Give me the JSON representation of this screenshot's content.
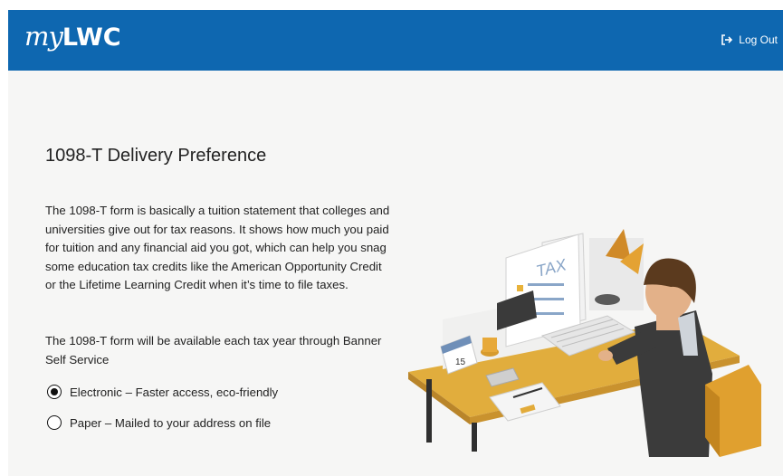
{
  "header": {
    "logo_my": "my",
    "logo_lwc": "LWC",
    "logout_label": "Log Out",
    "logout_icon": "logout-icon",
    "bar_color": "#0e67b0"
  },
  "main": {
    "title": "1098-T Delivery Preference",
    "description": "The 1098-T form is basically a tuition statement that colleges and universities give out for tax reasons. It shows how much you paid for tuition and any financial aid you got, which can help you snag some education tax credits like the American Opportunity Credit or the Lifetime Learning Credit when it’s time to file taxes.",
    "availability": "The 1098-T form will be available each tax year through Banner Self Service",
    "options": [
      {
        "label": "Electronic – Faster access, eco-friendly",
        "selected": true
      },
      {
        "label": "Paper – Mailed to your address on file",
        "selected": false
      }
    ]
  },
  "illustration": {
    "document_label": "TAX",
    "calendar_day": "15"
  }
}
